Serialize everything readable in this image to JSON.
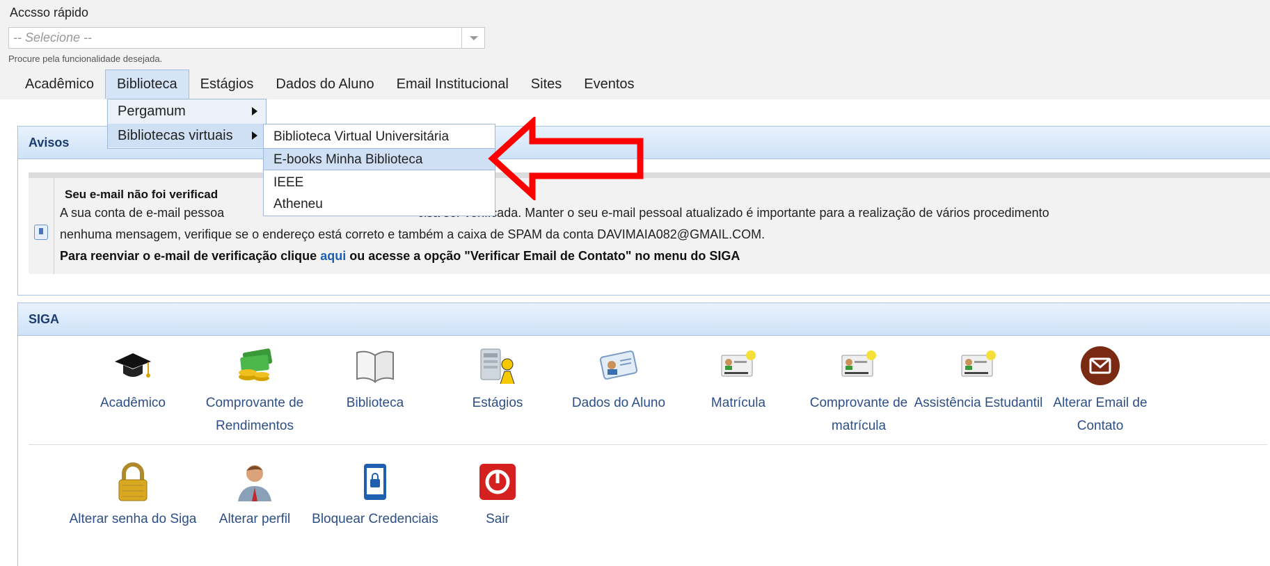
{
  "quick_access": {
    "label": "Accsso rápido",
    "select_value": "-- Selecione --",
    "hint": "Procure pela funcionalidade desejada."
  },
  "menu": {
    "items": [
      "Acadêmico",
      "Biblioteca",
      "Estágios",
      "Dados do Aluno",
      "Email Institucional",
      "Sites",
      "Eventos"
    ],
    "active": "Biblioteca"
  },
  "biblioteca_menu": {
    "items": [
      {
        "label": "Pergamum"
      },
      {
        "label": "Bibliotecas virtuais"
      }
    ]
  },
  "virtual_libraries_menu": {
    "items": [
      {
        "label": "Biblioteca Virtual Universitária"
      },
      {
        "label": "E-books Minha Biblioteca"
      },
      {
        "label": "IEEE"
      },
      {
        "label": "Atheneu"
      }
    ],
    "highlighted": "E-books Minha Biblioteca"
  },
  "avisos": {
    "title": "Avisos",
    "notice_title": "Seu e-mail não foi verificad",
    "line1_a": "A sua conta de e-mail pessoa",
    "line1_b": "cisa ser verificada. Manter o seu e-mail pessoal atualizado é importante para a realização de vários procedimento",
    "line2": "nenhuma mensagem, verifique se o endereço está correto e também a caixa de SPAM da conta DAVIMAIA082@GMAIL.COM.",
    "line3_pre": "Para reenviar o e-mail de verificação clique ",
    "line3_link": "aqui",
    "line3_post": " ou acesse a opção \"Verificar Email de Contato\" no menu do SIGA"
  },
  "siga": {
    "title": "SIGA",
    "row1": [
      {
        "label": "Acadêmico",
        "icon": "graduation-cap-icon"
      },
      {
        "label": "Comprovante de Rendimentos",
        "icon": "money-icon"
      },
      {
        "label": "Biblioteca",
        "icon": "book-icon"
      },
      {
        "label": "Estágios",
        "icon": "worker-icon"
      },
      {
        "label": "Dados do Aluno",
        "icon": "id-card-icon"
      },
      {
        "label": "Matrícula",
        "icon": "badge-icon"
      },
      {
        "label": "Comprovante de matrícula",
        "icon": "badge-icon"
      },
      {
        "label": "Assistência Estudantil",
        "icon": "badge-icon"
      },
      {
        "label": "Alterar Email de Contato",
        "icon": "envelope-icon"
      }
    ],
    "row2": [
      {
        "label": "Alterar senha do Siga",
        "icon": "padlock-icon"
      },
      {
        "label": "Alterar perfil",
        "icon": "user-icon"
      },
      {
        "label": "Bloquear Credenciais",
        "icon": "phone-lock-icon"
      },
      {
        "label": "Sair",
        "icon": "power-icon"
      }
    ]
  },
  "colors": {
    "accent_blue": "#2d4f86",
    "panel_header": "#cfe2f8",
    "arrow_red": "#ff0000"
  }
}
